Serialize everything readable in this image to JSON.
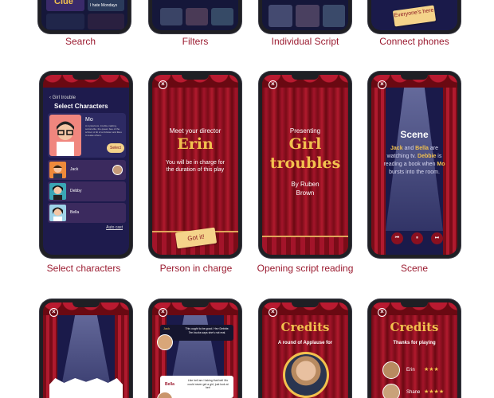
{
  "captions": {
    "search": "Search",
    "filters": "Filters",
    "individual_script": "Individual Script",
    "connect_phones": "Connect phones",
    "select_characters": "Select characters",
    "person_in_charge": "Person in charge",
    "opening_script": "Opening script reading",
    "scene": "Scene"
  },
  "top_row": {
    "search_tiles": [
      "Clue",
      "I hate Mondays"
    ],
    "connect_ticket": "Everyone's here"
  },
  "select_characters": {
    "back_label": "Girl trouble",
    "title": "Select Characters",
    "featured_name": "Mo",
    "featured_desc": "A mysterious, trouble-making, social elite, the queen bee of the school. A bit of a trickster and likes to tease others.",
    "select_button": "Select",
    "list": [
      "Jack",
      "Debby",
      "Bella"
    ],
    "auto_cast": "Auto cast"
  },
  "person_in_charge": {
    "line1": "Meet your director",
    "name": "Erin",
    "line2": "You will be in charge for the duration of this play",
    "ticket": "Got it!"
  },
  "opening": {
    "presenting": "Presenting",
    "title_line1": "Girl",
    "title_line2": "troubles",
    "by": "By Ruben Brown"
  },
  "scene": {
    "heading": "Scene",
    "text_parts": [
      "Jack",
      " and ",
      "Bella",
      " are watching tv. ",
      "Debbie",
      " is reading a book when ",
      "Mo",
      " bursts into the room."
    ]
  },
  "dialogue": {
    "bubble1_name": "Jack",
    "bubble1": "This ought to be good. Hev Debbie. Ten bucks says she's not real.",
    "bubble2_name": "Bella",
    "bubble2": "Like hell am I taking that bet! Mo could never get a girl, just look at her!"
  },
  "credits1": {
    "title": "Credits",
    "subtitle": "A round of Applause for"
  },
  "credits2": {
    "title": "Credits",
    "subtitle": "Thanks for playing",
    "players": [
      {
        "name": "Erin",
        "stars": "★★★"
      },
      {
        "name": "Shane",
        "stars": "★★★★"
      }
    ]
  },
  "colors": {
    "caption": "#9b1b30",
    "curtain": "#a3142a",
    "gold": "#f2c14e",
    "navy": "#1a1a4a"
  }
}
